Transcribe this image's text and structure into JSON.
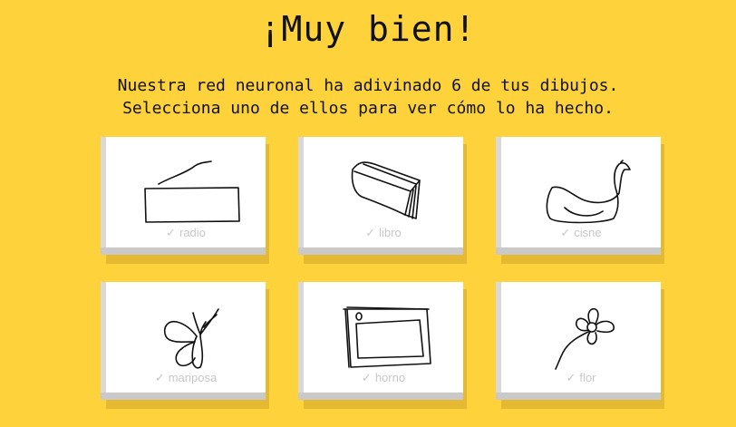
{
  "title": "¡Muy bien!",
  "subtitle_line1": "Nuestra red neuronal ha adivinado 6 de tus dibujos.",
  "subtitle_line2": "Selecciona uno de ellos para ver cómo lo ha hecho.",
  "check_mark": "✓",
  "cards": [
    {
      "label": "radio",
      "icon": "radio-drawing"
    },
    {
      "label": "libro",
      "icon": "book-drawing"
    },
    {
      "label": "cisne",
      "icon": "swan-drawing"
    },
    {
      "label": "mariposa",
      "icon": "butterfly-drawing"
    },
    {
      "label": "horno",
      "icon": "oven-drawing"
    },
    {
      "label": "flor",
      "icon": "flower-drawing"
    }
  ]
}
